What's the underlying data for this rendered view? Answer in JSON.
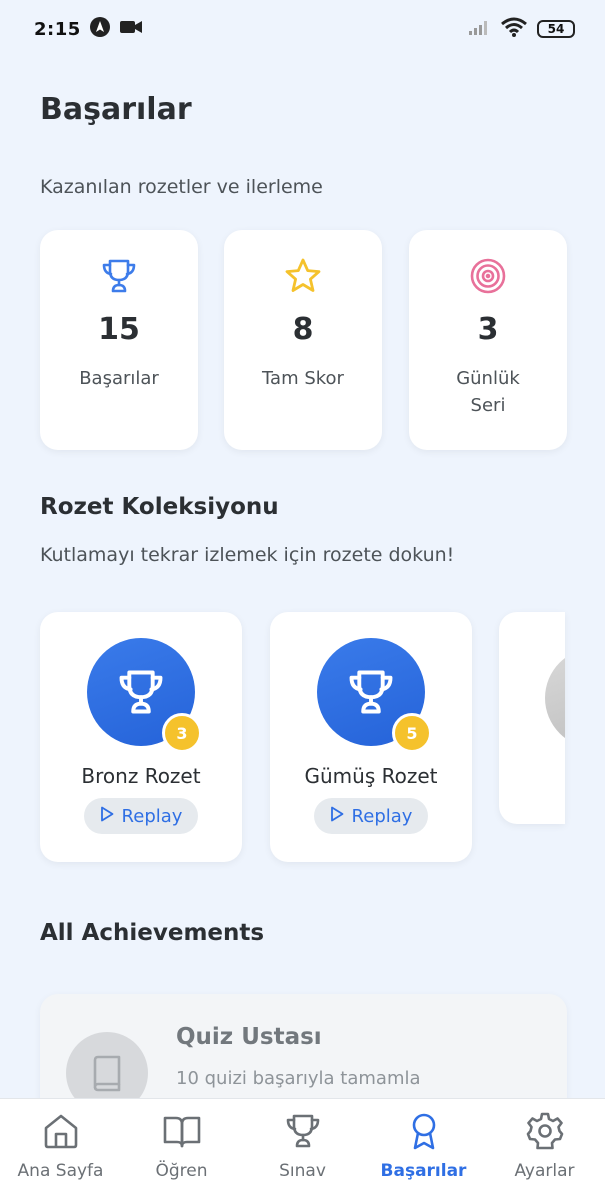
{
  "status_bar": {
    "time": "2:15",
    "battery": "54",
    "icons": [
      "navigation-icon",
      "video-camera-icon",
      "signal-icon",
      "wifi-icon",
      "battery-icon"
    ]
  },
  "header": {
    "title": "Başarılar",
    "subtitle": "Kazanılan rozetler ve ilerleme"
  },
  "stats": [
    {
      "icon": "trophy-icon",
      "value": "15",
      "label": "Başarılar",
      "color": "#3d7cea"
    },
    {
      "icon": "star-icon",
      "value": "8",
      "label": "Tam Skor",
      "color": "#f5c22c"
    },
    {
      "icon": "target-icon",
      "value": "3",
      "label": "Günlük Seri",
      "color": "#e8719a"
    }
  ],
  "badges_section": {
    "title": "Rozet Koleksiyonu",
    "subtitle": "Kutlamayı tekrar izlemek için rozete dokun!",
    "badges": [
      {
        "name": "Bronz Rozet",
        "count": "3",
        "replay_label": "Replay",
        "icon": "trophy-icon"
      },
      {
        "name": "Gümüş Rozet",
        "count": "5",
        "replay_label": "Replay",
        "icon": "trophy-icon"
      }
    ]
  },
  "achievements_section": {
    "title": "All Achievements",
    "items": [
      {
        "title": "Quiz Ustası",
        "description": "10 quizi başarıyla tamamla",
        "icon": "book-icon"
      }
    ]
  },
  "bottom_nav": {
    "items": [
      {
        "label": "Ana Sayfa",
        "icon": "home-icon"
      },
      {
        "label": "Öğren",
        "icon": "book-open-icon"
      },
      {
        "label": "Sınav",
        "icon": "trophy-icon"
      },
      {
        "label": "Başarılar",
        "icon": "award-icon",
        "active": true
      },
      {
        "label": "Ayarlar",
        "icon": "gear-icon"
      }
    ]
  },
  "colors": {
    "accent": "#2f6fe4",
    "background": "#eef4fd",
    "badge_gold": "#f5c22c"
  }
}
